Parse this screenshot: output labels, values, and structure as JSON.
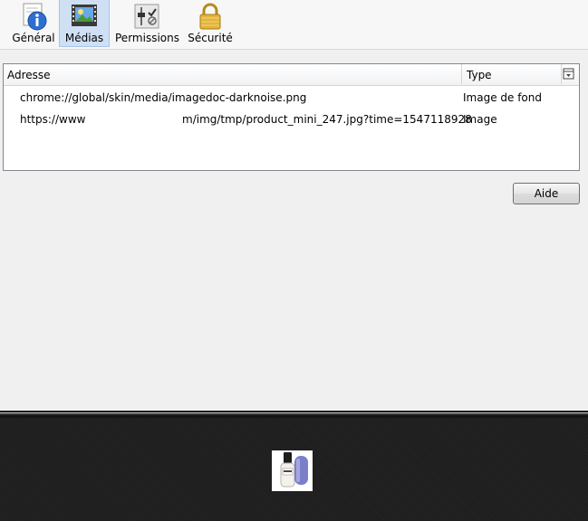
{
  "toolbar": {
    "tabs": [
      {
        "label": "Général",
        "icon": "info-icon"
      },
      {
        "label": "Médias",
        "icon": "media-icon"
      },
      {
        "label": "Permissions",
        "icon": "permissions-icon"
      },
      {
        "label": "Sécurité",
        "icon": "lock-icon"
      }
    ],
    "active_tab": "Médias"
  },
  "media_table": {
    "columns": [
      "Adresse",
      "Type"
    ],
    "rows": [
      {
        "address": "chrome://global/skin/media/imagedoc-darknoise.png",
        "type": "Image de fond"
      },
      {
        "address_start": "https://www",
        "address_end": "m/img/tmp/product_mini_247.jpg?time=1547118928",
        "type": "Image"
      }
    ]
  },
  "help_button": {
    "label": "Aide"
  },
  "preview": {
    "image": "nail-polish-product-thumbnail"
  }
}
